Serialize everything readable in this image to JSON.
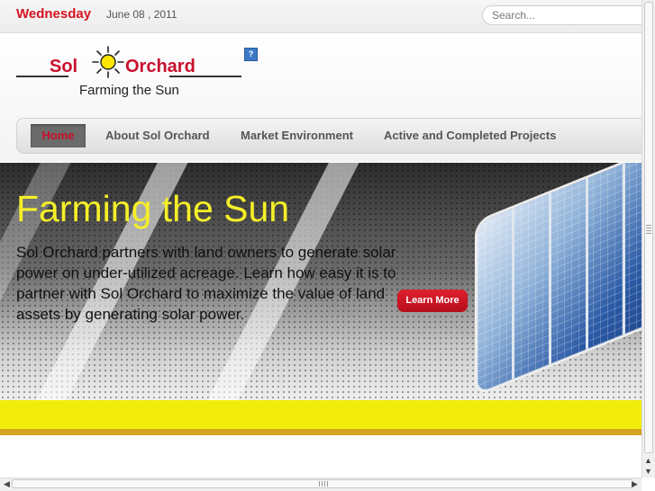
{
  "topbar": {
    "day": "Wednesday",
    "date": "June 08 , 2011",
    "search_placeholder": "Search..."
  },
  "logo": {
    "sol": "Sol",
    "orchard": "Orchard",
    "tagline": "Farming the Sun",
    "help_icon": "?"
  },
  "nav": {
    "items": [
      "Home",
      "About Sol Orchard",
      "Market Environment",
      "Active and Completed Projects"
    ]
  },
  "banner": {
    "headline": "Farming the Sun",
    "body": "Sol Orchard partners with land owners to generate solar power on under-utilized acreage.  Learn how easy it is to partner with Sol Orchard to maximize the value of land assets by generating solar power.",
    "button": "Learn More"
  },
  "colors": {
    "accent_red": "#c8102e",
    "headline_yellow": "#f5ef28",
    "band_yellow": "#f2ec0c"
  },
  "icons": [
    "sun-logo-icon",
    "help-icon",
    "scroll-up-icon",
    "scroll-down-icon",
    "scroll-left-icon",
    "scroll-right-icon"
  ]
}
